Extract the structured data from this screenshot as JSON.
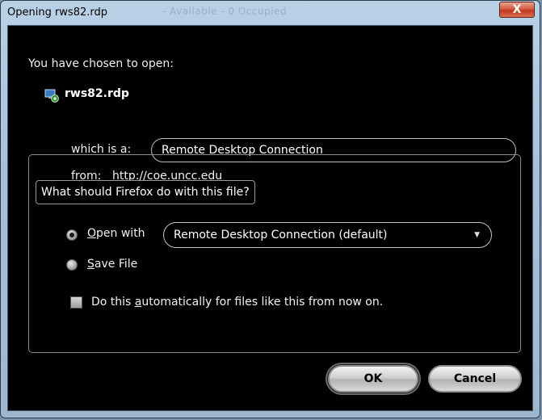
{
  "window": {
    "title": "Opening rws82.rdp",
    "ghost_title": "- Available - 0 Occupied",
    "close_glyph": "X"
  },
  "dialog": {
    "intro": "You have chosen to open:",
    "file_name": "rws82.rdp",
    "file_icon": "remote-desktop-file-icon",
    "which_is_label": "which is a:",
    "file_type": "Remote Desktop Connection",
    "from_label": "from:",
    "from_url": "http://coe.uncc.edu"
  },
  "options": {
    "group_label": "What should Firefox do with this file?",
    "open_with": {
      "mnemonic": "O",
      "rest": "pen with",
      "selected": true
    },
    "open_with_app": "Remote Desktop Connection (default)",
    "save_file": {
      "mnemonic": "S",
      "rest": "ave File",
      "selected": false
    },
    "auto_checkbox": {
      "before": "Do this ",
      "mnemonic": "a",
      "after": "utomatically for files like this from now on.",
      "checked": false
    }
  },
  "buttons": {
    "ok": "OK",
    "cancel": "Cancel"
  },
  "colors": {
    "dialog_background": "#000000",
    "frame": "#a6c1d9",
    "close_button": "#c2371c"
  }
}
